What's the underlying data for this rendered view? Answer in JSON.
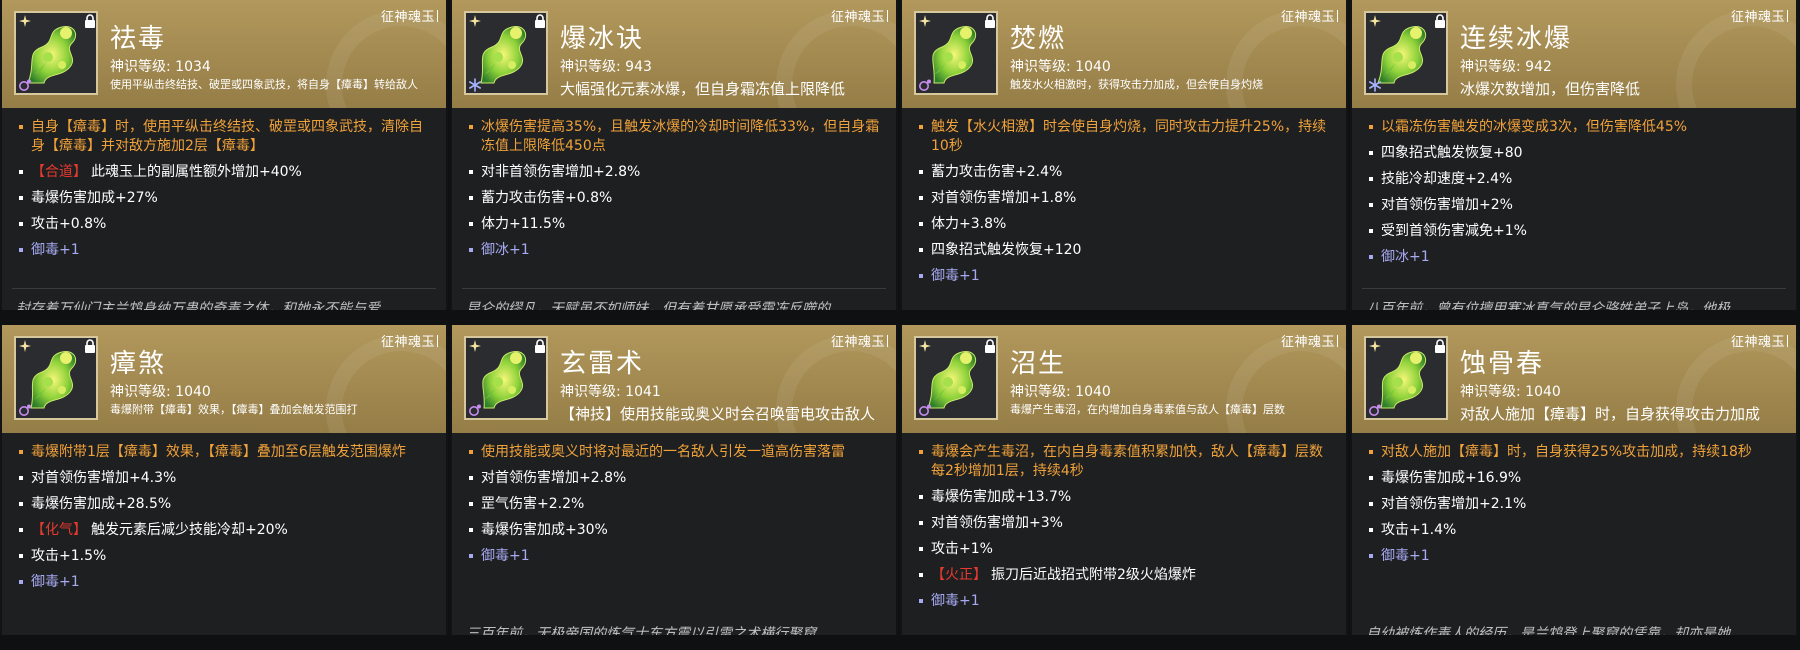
{
  "series_label": "征神魂玉",
  "level_prefix": "神识等级: ",
  "cards": [
    {
      "id": "card-1",
      "title": "祛毒",
      "level": "1034",
      "desc": "使用平纵击终结技、破罡或四象武技，将自身【瘴毒】转给敌人",
      "desc_style": "small-wrap",
      "element": "poison",
      "lines": [
        {
          "color": "orange",
          "text": "自身【瘴毒】时，使用平纵击终结技、破罡或四象武技，清除自身【瘴毒】并对敌方施加2层【瘴毒】"
        },
        {
          "color": "white",
          "tag": "【合道】",
          "text": "此魂玉上的副属性额外增加+40%"
        },
        {
          "color": "white",
          "text": "毒爆伤害加成+27%"
        },
        {
          "color": "white",
          "text": "攻击+0.8%"
        },
        {
          "color": "blue",
          "text": "御毒+1"
        }
      ],
      "lore": "封存着万仙门主兰鸩身纳万蛊的奇毒之体，和她永不能与爱"
    },
    {
      "id": "card-2",
      "title": "爆冰诀",
      "level": "943",
      "desc": "大幅强化元素冰爆，但自身霜冻值上限降低",
      "desc_style": "big",
      "element": "ice",
      "lines": [
        {
          "color": "orange",
          "text": "冰爆伤害提高35%，且触发冰爆的冷却时间降低33%，但自身霜冻值上限降低450点"
        },
        {
          "color": "white",
          "text": "对非首领伤害增加+2.8%"
        },
        {
          "color": "white",
          "text": "蓄力攻击伤害+0.8%"
        },
        {
          "color": "white",
          "text": "体力+11.5%"
        },
        {
          "color": "blue",
          "text": "御冰+1"
        }
      ],
      "lore": "昆仑的缪凡，天赋虽不如师妹，但有着甘愿承受霜冻反噬的"
    },
    {
      "id": "card-3",
      "title": "焚燃",
      "level": "1040",
      "desc": "触发水火相激时，获得攻击力加成，但会使自身灼烧",
      "desc_style": "small",
      "element": "poison",
      "lines": [
        {
          "color": "orange",
          "text": "触发【水火相激】时会使自身灼烧，同时攻击力提升25%，持续10秒"
        },
        {
          "color": "white",
          "text": "蓄力攻击伤害+2.4%"
        },
        {
          "color": "white",
          "text": "对首领伤害增加+1.8%"
        },
        {
          "color": "white",
          "text": "体力+3.8%"
        },
        {
          "color": "white",
          "text": "四象招式触发恢复+120"
        },
        {
          "color": "blue",
          "text": "御毒+1"
        }
      ],
      "lore": ""
    },
    {
      "id": "card-4",
      "title": "连续冰爆",
      "level": "942",
      "desc": "冰爆次数增加，但伤害降低",
      "desc_style": "big",
      "element": "ice",
      "lines": [
        {
          "color": "orange",
          "text": "以霜冻伤害触发的冰爆变成3次，但伤害降低45%"
        },
        {
          "color": "white",
          "text": "四象招式触发恢复+80"
        },
        {
          "color": "white",
          "text": "技能冷却速度+2.4%"
        },
        {
          "color": "white",
          "text": "对首领伤害增加+2%"
        },
        {
          "color": "white",
          "text": "受到首领伤害减免+1%"
        },
        {
          "color": "blue",
          "text": "御冰+1"
        }
      ],
      "lore": "八百年前，曾有位擅用寒冰真气的昆仑骆姓弟子上岛，他极"
    },
    {
      "id": "card-5",
      "title": "瘴煞",
      "level": "1040",
      "desc": "毒爆附带【瘴毒】效果，【瘴毒】叠加会触发范围打",
      "desc_style": "small",
      "element": "poison",
      "lines": [
        {
          "color": "orange",
          "text": "毒爆附带1层【瘴毒】效果，【瘴毒】叠加至6层触发范围爆炸"
        },
        {
          "color": "white",
          "text": "对首领伤害增加+4.3%"
        },
        {
          "color": "white",
          "text": "毒爆伤害加成+28.5%"
        },
        {
          "color": "white",
          "tag": "【化气】",
          "text": "触发元素后减少技能冷却+20%"
        },
        {
          "color": "white",
          "text": "攻击+1.5%"
        },
        {
          "color": "blue",
          "text": "御毒+1"
        }
      ],
      "lore": ""
    },
    {
      "id": "card-6",
      "title": "玄雷术",
      "level": "1041",
      "desc": "【神技】使用技能或奥义时会召唤雷电攻击敌人",
      "desc_style": "medium",
      "element": "poison",
      "lines": [
        {
          "color": "orange",
          "text": "使用技能或奥义时将对最近的一名敌人引发一道高伤害落雷"
        },
        {
          "color": "white",
          "text": "对首领伤害增加+2.8%"
        },
        {
          "color": "white",
          "text": "罡气伤害+2.2%"
        },
        {
          "color": "white",
          "text": "毒爆伤害加成+30%"
        },
        {
          "color": "blue",
          "text": "御毒+1"
        }
      ],
      "lore": "三百年前，无极帝国的炼气士东方震以引雷之术横行聚窟"
    },
    {
      "id": "card-7",
      "title": "沼生",
      "level": "1040",
      "desc": "毒爆产生毒沼，在内增加自身毒素值与敌人【瘴毒】层数",
      "desc_style": "small",
      "element": "poison",
      "lines": [
        {
          "color": "orange",
          "text": "毒爆会产生毒沼，在内自身毒素值积累加快，敌人【瘴毒】层数每2秒增加1层，持续4秒"
        },
        {
          "color": "white",
          "text": "毒爆伤害加成+13.7%"
        },
        {
          "color": "white",
          "text": "对首领伤害增加+3%"
        },
        {
          "color": "white",
          "text": "攻击+1%"
        },
        {
          "color": "white",
          "tag": "【火正】",
          "text": "振刀后近战招式附带2级火焰爆炸"
        },
        {
          "color": "blue",
          "text": "御毒+1"
        }
      ],
      "lore": ""
    },
    {
      "id": "card-8",
      "title": "蚀骨春",
      "level": "1040",
      "desc": "对敌人施加【瘴毒】时，自身获得攻击力加成",
      "desc_style": "medium",
      "element": "poison",
      "lines": [
        {
          "color": "orange",
          "text": "对敌人施加【瘴毒】时，自身获得25%攻击加成，持续18秒"
        },
        {
          "color": "white",
          "text": "毒爆伤害加成+16.9%"
        },
        {
          "color": "white",
          "text": "对首领伤害增加+2.1%"
        },
        {
          "color": "white",
          "text": "攻击+1.4%"
        },
        {
          "color": "blue",
          "text": "御毒+1"
        }
      ],
      "lore": "自幼被炼作毒人的经历，是兰鸩登上聚窟的凭靠，却亦是她"
    }
  ],
  "colors": {
    "header_gold": "#a28950",
    "card_bg": "#1e1f21",
    "effect_orange": "#f0a23a",
    "stat_white": "#ffffff",
    "resist_blue": "#a7a9f2",
    "tag_red": "#e53a30",
    "lore_gray": "#bfc0c2"
  },
  "icons": {
    "corner": "star-mark-icon",
    "lock": "lock-icon",
    "poison": "poison-element-icon",
    "ice": "frost-element-icon",
    "artwork": "soul-jade-artwork"
  }
}
